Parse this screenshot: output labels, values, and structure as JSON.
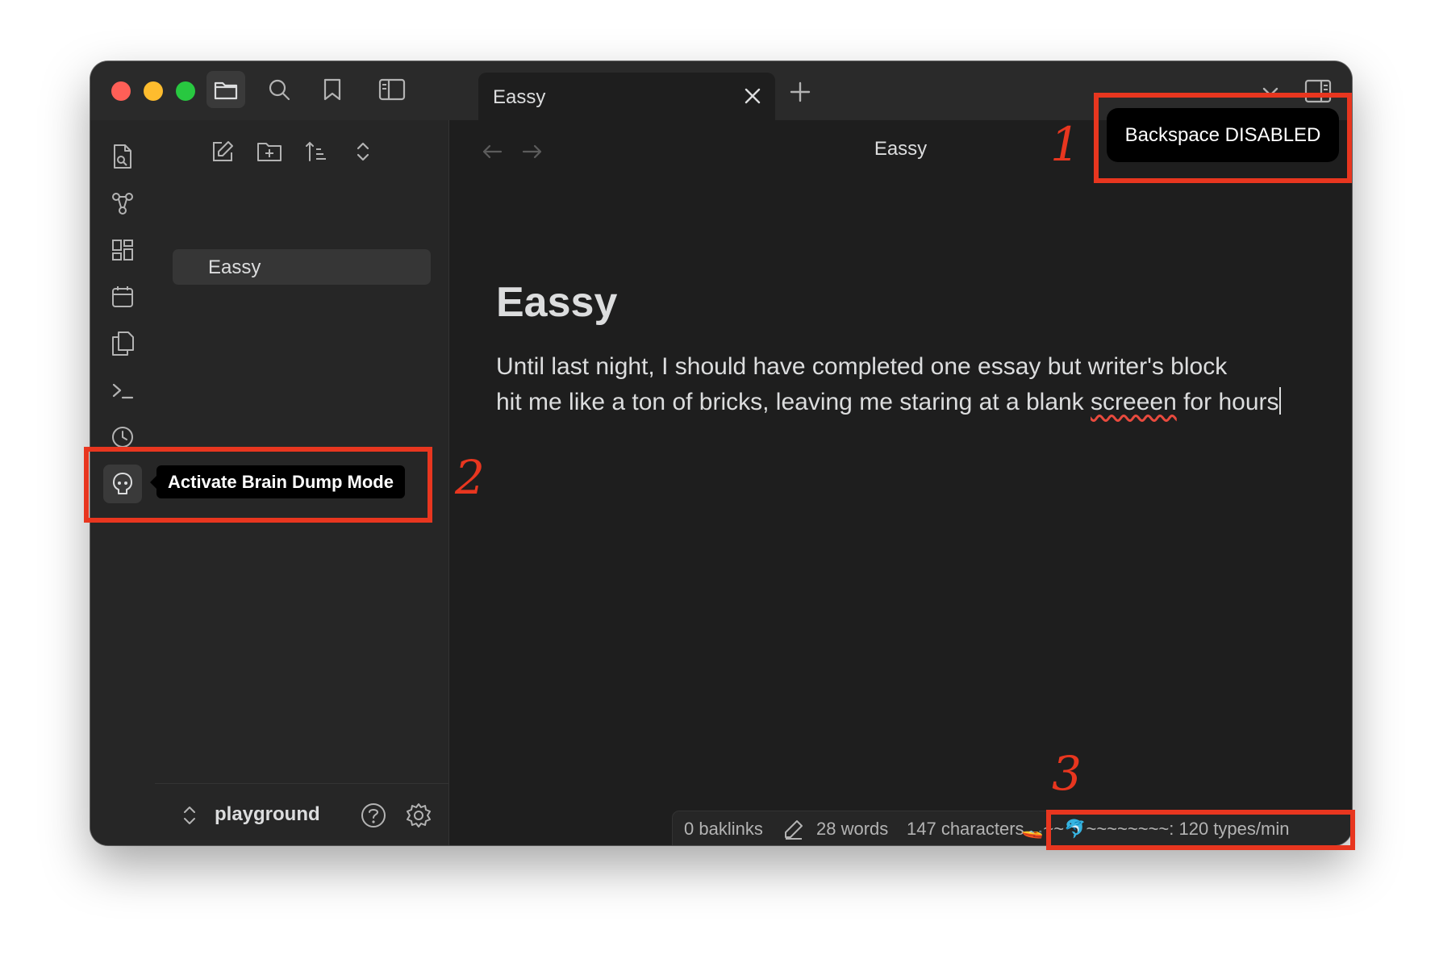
{
  "titlebar": {
    "tab_title": "Eassy"
  },
  "explorer": {
    "files": [
      "Eassy"
    ],
    "vault_name": "playground"
  },
  "editor": {
    "view_title": "Eassy",
    "doc_title": "Eassy",
    "body_line1": "Until last night, I should have completed one essay but writer's block",
    "body_line2_pre": "hit me like a ton of bricks, leaving me staring at a blank ",
    "body_misspelled": "screeen",
    "body_line2_post": " for hours"
  },
  "status": {
    "backlinks": "0 baklinks",
    "words": "28 words",
    "characters": "147 characters",
    "typing_speed": "🚤~~🐬~~~~~~~~: 120 types/min"
  },
  "notice": {
    "text": "Backspace DISABLED"
  },
  "tooltip": {
    "text": "Activate Brain Dump Mode"
  },
  "annotations": {
    "n1": "1",
    "n2": "2",
    "n3": "3",
    "color": "#e8361f"
  },
  "colors": {
    "window_bg": "#1e1e1e",
    "sidebar_bg": "#262626",
    "text": "#dcddde",
    "muted": "#b3b3b3"
  }
}
